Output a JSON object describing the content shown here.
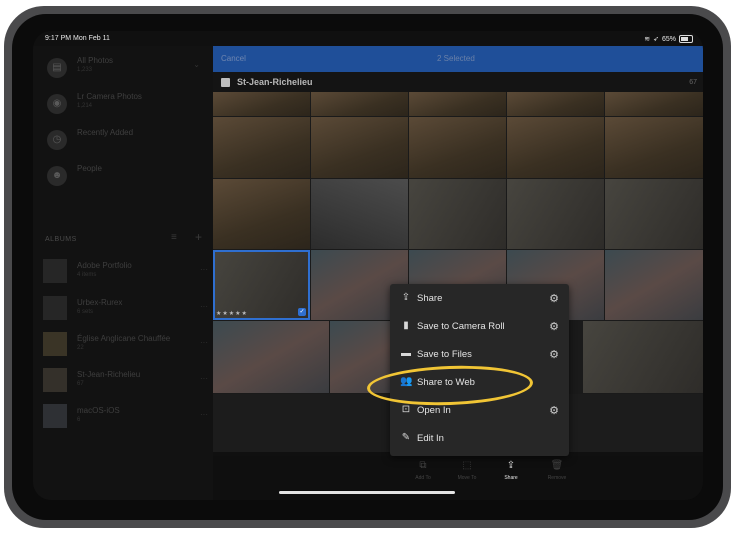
{
  "status_bar": {
    "time": "9:17 PM  Mon Feb 11",
    "battery": "65%"
  },
  "sidebar": {
    "items": [
      {
        "title": "All Photos",
        "sub": "1,233"
      },
      {
        "title": "Lr Camera Photos",
        "sub": "1,214"
      },
      {
        "title": "Recently Added",
        "sub": ""
      },
      {
        "title": "People",
        "sub": ""
      }
    ],
    "albums_header": "ALBUMS",
    "albums": [
      {
        "title": "Adobe Portfolio",
        "sub": "4 items"
      },
      {
        "title": "Urbex-Rurex",
        "sub": "6 sets"
      },
      {
        "title": "Église Anglicane Chauffée",
        "sub": "22"
      },
      {
        "title": "St-Jean-Richelieu",
        "sub": "67"
      },
      {
        "title": "macOS-iOS",
        "sub": "6"
      }
    ]
  },
  "topbar": {
    "cancel": "Cancel",
    "selected": "2 Selected"
  },
  "group": {
    "title": "St-Jean-Richelieu",
    "count": "67"
  },
  "photo_rating": "★★★★★",
  "menu": {
    "items": [
      {
        "label": "Share",
        "icon": "share-icon",
        "gear": true
      },
      {
        "label": "Save to Camera Roll",
        "icon": "camera-roll-icon",
        "gear": true
      },
      {
        "label": "Save to Files",
        "icon": "folder-icon",
        "gear": true
      },
      {
        "label": "Share to Web",
        "icon": "people-icon",
        "gear": false
      },
      {
        "label": "Open In",
        "icon": "open-in-icon",
        "gear": true
      },
      {
        "label": "Edit In",
        "icon": "edit-in-icon",
        "gear": false
      }
    ]
  },
  "toolbar": {
    "add_to": "Add To",
    "move_to": "Move To",
    "share": "Share",
    "remove": "Remove"
  },
  "colors": {
    "accent": "#1f4f99",
    "highlight": "#f1c535"
  }
}
